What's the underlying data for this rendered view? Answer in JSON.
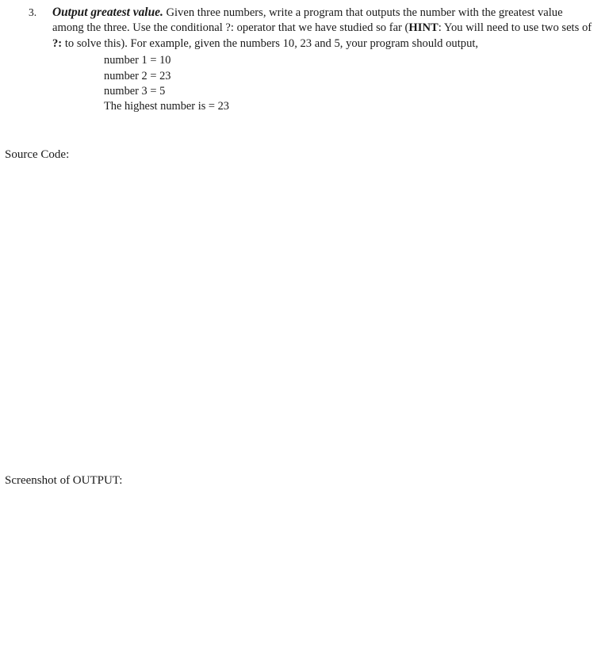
{
  "document": {
    "question": {
      "marker": "3.",
      "title": "Output greatest value.",
      "paragraph_part_1": " Given three numbers, write a program that outputs the number with the greatest value among the three. Use the conditional ?: operator that we have studied so far (",
      "hint_label": "HINT",
      "paragraph_part_2": ": You will need to use two sets of ",
      "operator_emphasis": "?:",
      "paragraph_part_3": " to solve this). For example, given the numbers 10, 23 and 5, your program should output,",
      "sample_output": [
        "number 1 = 10",
        "number 2 = 23",
        "number 3 = 5",
        "The highest number is = 23"
      ]
    },
    "sections": [
      {
        "label": "Source Code:"
      },
      {
        "label": "Screenshot of OUTPUT:"
      }
    ],
    "labels": {
      "source_code": "Source Code:",
      "screenshot_output": "Screenshot of OUTPUT:"
    },
    "colors": {
      "background": "#ffffff",
      "text": "#1a1a1a"
    }
  }
}
